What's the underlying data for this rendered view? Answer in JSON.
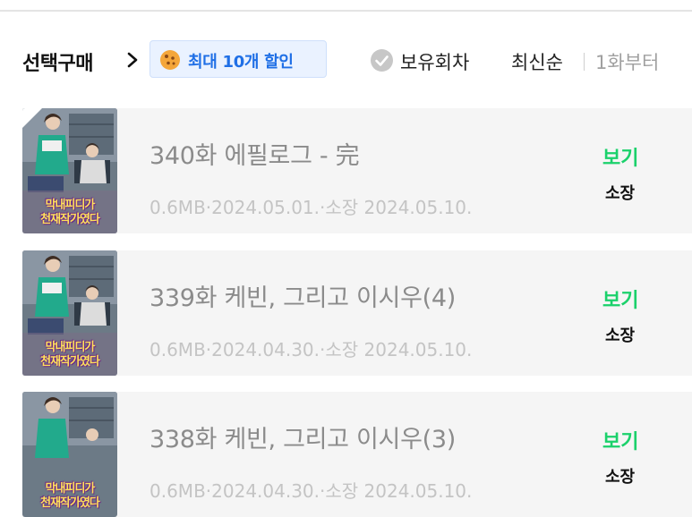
{
  "header": {
    "select_purchase": "선택구매",
    "discount_badge": "최대 10개 할인",
    "owned_filter": "보유회차",
    "sort_newest": "최신순",
    "sort_first": "1화부터"
  },
  "episodes": [
    {
      "thumbnail_title_line1": "막내피디가",
      "thumbnail_title_line2": "천재작가였다",
      "title": "340화 에필로그 - 完",
      "meta": "0.6MB·2024.05.01.·소장 2024.05.10.",
      "view_label": "보기",
      "status": "소장"
    },
    {
      "thumbnail_title_line1": "막내피디가",
      "thumbnail_title_line2": "천재작가였다",
      "title": "339화 케빈, 그리고 이시우(4)",
      "meta": "0.6MB·2024.04.30.·소장 2024.05.10.",
      "view_label": "보기",
      "status": "소장"
    },
    {
      "thumbnail_title_line1": "막내피디가",
      "thumbnail_title_line2": "천재작가였다",
      "title": "338화 케빈, 그리고 이시우(3)",
      "meta": "0.6MB·2024.04.30.·소장 2024.05.10.",
      "view_label": "보기",
      "status": "소장"
    }
  ],
  "colors": {
    "view_green": "#1bd16b",
    "discount_blue": "#1f6fe6",
    "discount_bg": "#eaf2ff"
  },
  "icons": {
    "chevron": "chevron-right-icon",
    "cookie": "cookie-icon",
    "check": "check-circle-icon"
  }
}
